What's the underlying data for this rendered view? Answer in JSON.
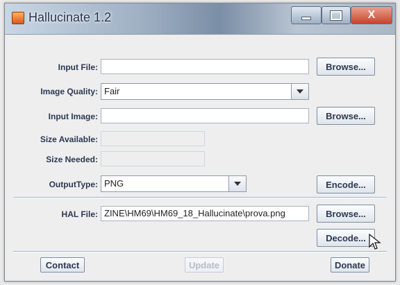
{
  "window": {
    "title": "Hallucinate 1.2",
    "controls": {
      "minimize": "",
      "maximize": "",
      "close": "X"
    }
  },
  "form": {
    "input_file": {
      "label": "Input File:",
      "value": ""
    },
    "image_quality": {
      "label": "Image Quality:",
      "selected": "Fair"
    },
    "input_image": {
      "label": "Input Image:",
      "value": ""
    },
    "size_available": {
      "label": "Size Available:",
      "value": ""
    },
    "size_needed": {
      "label": "Size Needed:",
      "value": ""
    },
    "output_type": {
      "label": "OutputType:",
      "selected": "PNG"
    },
    "hal_file": {
      "label": "HAL File:",
      "value": "ZINE\\HM69\\HM69_18_Hallucinate\\prova.png"
    }
  },
  "buttons": {
    "browse": "Browse...",
    "encode": "Encode...",
    "decode": "Decode...",
    "contact": "Contact",
    "update": "Update",
    "donate": "Donate"
  },
  "icons": {
    "app": "java-cup-icon",
    "dropdown": "triangle-down-icon",
    "cursor": "mouse-pointer-icon"
  },
  "colors": {
    "label_text": "#2c3852",
    "field_border": "#a5b2c4",
    "close_red": "#c9432a"
  }
}
